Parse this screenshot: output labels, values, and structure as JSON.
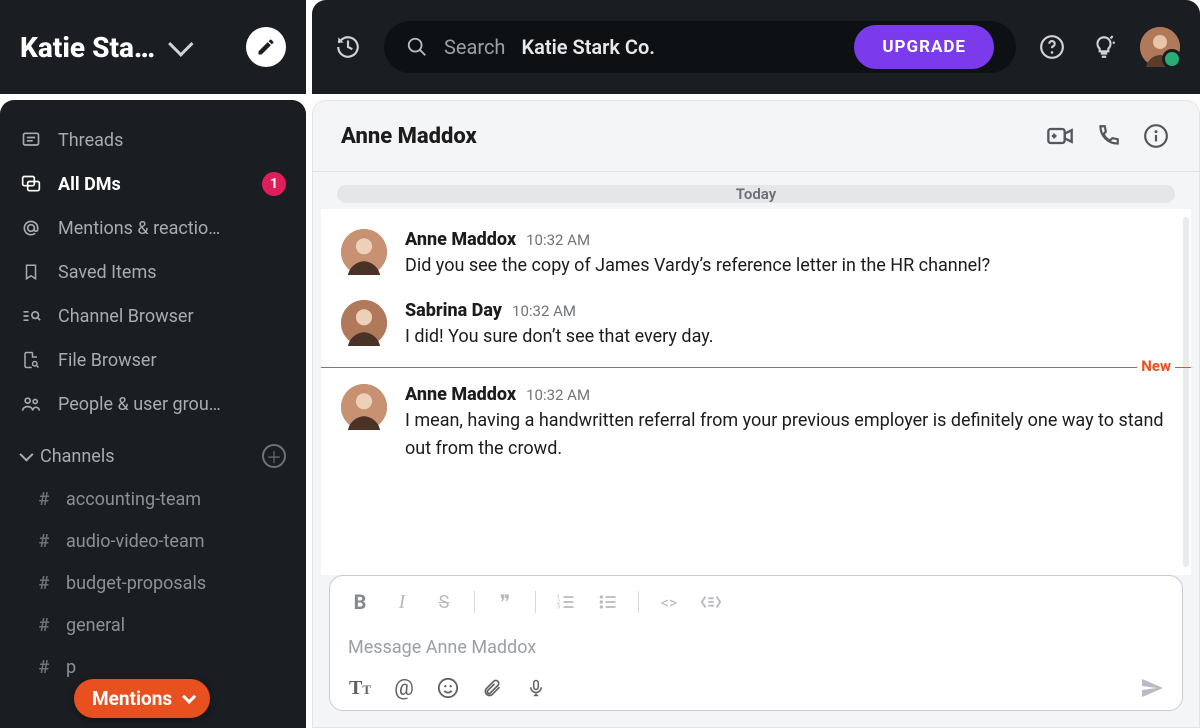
{
  "workspace": {
    "name": "Katie Sta…"
  },
  "search": {
    "label": "Search",
    "context": "Katie Stark Co."
  },
  "upgrade": {
    "label": "UPGRADE"
  },
  "sidebar": {
    "nav": [
      {
        "icon": "threads-icon",
        "label": "Threads",
        "active": false
      },
      {
        "icon": "dms-icon",
        "label": "All DMs",
        "active": true,
        "badge": "1"
      },
      {
        "icon": "mentions-icon",
        "label": "Mentions & reactio…",
        "active": false
      },
      {
        "icon": "bookmark-icon",
        "label": "Saved Items",
        "active": false
      },
      {
        "icon": "browser-icon",
        "label": "Channel Browser",
        "active": false
      },
      {
        "icon": "filebrowse-icon",
        "label": "File Browser",
        "active": false
      },
      {
        "icon": "people-icon",
        "label": "People & user grou…",
        "active": false
      }
    ],
    "channels_header": "Channels",
    "channels": [
      {
        "name": "accounting-team"
      },
      {
        "name": "audio-video-team"
      },
      {
        "name": "budget-proposals"
      },
      {
        "name": "general"
      },
      {
        "name": "p"
      }
    ],
    "mentions_pill": "Mentions"
  },
  "conversation": {
    "title": "Anne Maddox",
    "date_divider": "Today",
    "new_label": "New",
    "messages": [
      {
        "sender": "Anne Maddox",
        "time": "10:32 AM",
        "text": "Did you see the copy of James Vardy’s reference letter in the HR channel?",
        "avatar": "av-anne"
      },
      {
        "sender": "Sabrina Day",
        "time": "10:32 AM",
        "text": "I did! You sure don’t see that every day.",
        "avatar": "av-sabrina"
      },
      {
        "sender": "Anne Maddox",
        "time": "10:32 AM",
        "text": "I mean, having a handwritten referral from your previous employer is definitely one way to stand out from the crowd.",
        "avatar": "av-anne",
        "after_new": true
      }
    ],
    "composer": {
      "placeholder": "Message Anne Maddox"
    }
  }
}
